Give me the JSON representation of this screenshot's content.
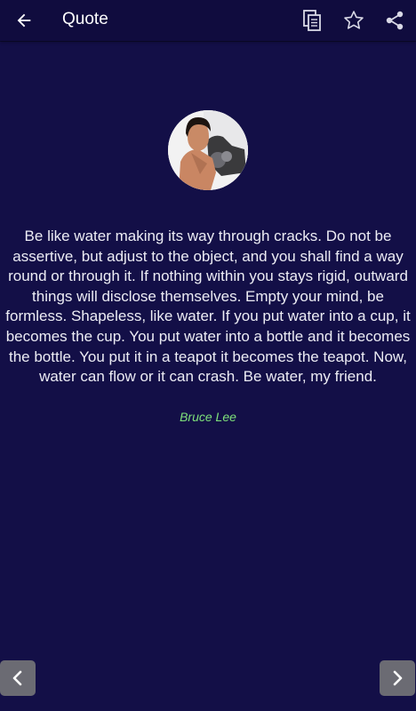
{
  "app_bar": {
    "title": "Quote",
    "icons": {
      "back": "arrow-left-icon",
      "copy": "copy-icon",
      "favorite": "star-outline-icon",
      "share": "share-icon"
    }
  },
  "quote": {
    "text": "Be like water making its way through cracks. Do not be assertive, but adjust to the object, and you shall find a way round or through it. If nothing within you stays rigid, outward things will disclose themselves. Empty your mind, be formless. Shapeless, like water. If you put water into a cup, it becomes the cup. You put water into a bottle and it becomes the bottle. You put it in a teapot it becomes the teapot. Now, water can flow or it can crash. Be water, my friend.",
    "author": "Bruce Lee"
  },
  "navigation": {
    "prev_icon": "chevron-left-icon",
    "next_icon": "chevron-right-icon"
  },
  "colors": {
    "background": "#130f47",
    "app_bar": "#100c3e",
    "quote_text": "#ececf4",
    "author": "#7ee07a",
    "nav_button": "#6b6b73"
  }
}
